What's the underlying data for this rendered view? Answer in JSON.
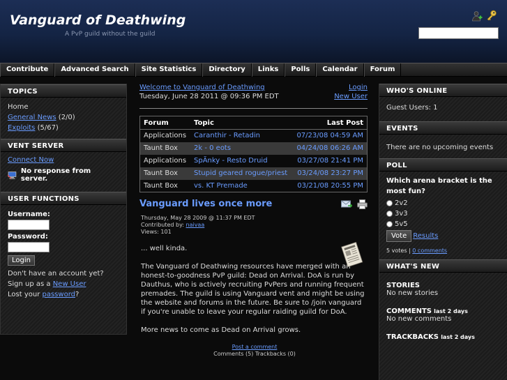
{
  "header": {
    "title": "Vanguard of Deathwing",
    "slogan": "A PvP guild without the guild",
    "search_value": ""
  },
  "nav": [
    "Contribute",
    "Advanced Search",
    "Site Statistics",
    "Directory",
    "Links",
    "Polls",
    "Calendar",
    "Forum"
  ],
  "left": {
    "topics": {
      "heading": "TOPICS",
      "home": "Home",
      "general_news": "General News",
      "general_news_count": "(2/0)",
      "exploits": "Exploits",
      "exploits_count": "(5/67)"
    },
    "vent": {
      "heading": "VENT SERVER",
      "connect": "Connect Now",
      "status": "No response from server."
    },
    "user": {
      "heading": "USER FUNCTIONS",
      "username_label": "Username:",
      "password_label": "Password:",
      "login_button": "Login",
      "signup_text": "Don't have an account yet? Sign up as a",
      "new_user": "New User",
      "lost_text": "Lost your",
      "password_link": "password",
      "lost_end": "?"
    }
  },
  "center": {
    "welcome": "Welcome to Vanguard of Deathwing",
    "login": "Login",
    "date": "Tuesday, June 28 2011 @ 09:36 PM EDT",
    "new_user": "New User",
    "forum": {
      "headers": [
        "Forum",
        "Topic",
        "Last Post"
      ],
      "rows": [
        [
          "Applications",
          "Caranthir - Retadin",
          "07/23/08 04:59 AM"
        ],
        [
          "Taunt Box",
          "2k - 0 eots",
          "04/24/08 06:26 AM"
        ],
        [
          "Applications",
          "SpÃnky - Resto Druid",
          "03/27/08 21:41 PM"
        ],
        [
          "Taunt Box",
          "Stupid geared rogue/priest",
          "03/24/08 23:27 PM"
        ],
        [
          "Taunt Box",
          "vs. KT Premade",
          "03/21/08 20:55 PM"
        ]
      ]
    },
    "story": {
      "title": "Vanguard lives once more",
      "posted": "Thursday, May 28 2009 @ 11:37 PM EDT",
      "contributed_prefix": "Contributed by:",
      "author": "naivaa",
      "views": "Views: 101",
      "p1": "... well kinda.",
      "p2": "The Vanguard of Deathwing resources have merged with an honest-to-goodness PvP guild: Dead on Arrival. DoA is run by Dauthus, who is actively recruiting PvPers and running frequent premades. The guild is using Vanguard vent and might be using the website and forums in the future. Be sure to /join vanguard if you're unable to leave your regular raiding guild for DoA.",
      "p3": "More news to come as Dead on Arrival grows.",
      "post_comment": "Post a comment",
      "comments_line": "Comments (5) Trackbacks (0)"
    }
  },
  "right": {
    "online": {
      "heading": "WHO'S ONLINE",
      "guests": "Guest Users: 1"
    },
    "events": {
      "heading": "EVENTS",
      "text": "There are no upcoming events"
    },
    "poll": {
      "heading": "POLL",
      "question": "Which arena bracket is the most fun?",
      "options": [
        "2v2",
        "3v3",
        "5v5"
      ],
      "vote": "Vote",
      "results": "Results",
      "votes": "5 votes |",
      "comments": "0 comments"
    },
    "whatsnew": {
      "heading": "WHAT'S NEW",
      "stories": "STORIES",
      "stories_text": "No new stories",
      "comments": "COMMENTS",
      "comments_period": "last 2 days",
      "comments_text": "No new comments",
      "trackbacks": "TRACKBACKS",
      "trackbacks_period": "last 2 days"
    }
  }
}
